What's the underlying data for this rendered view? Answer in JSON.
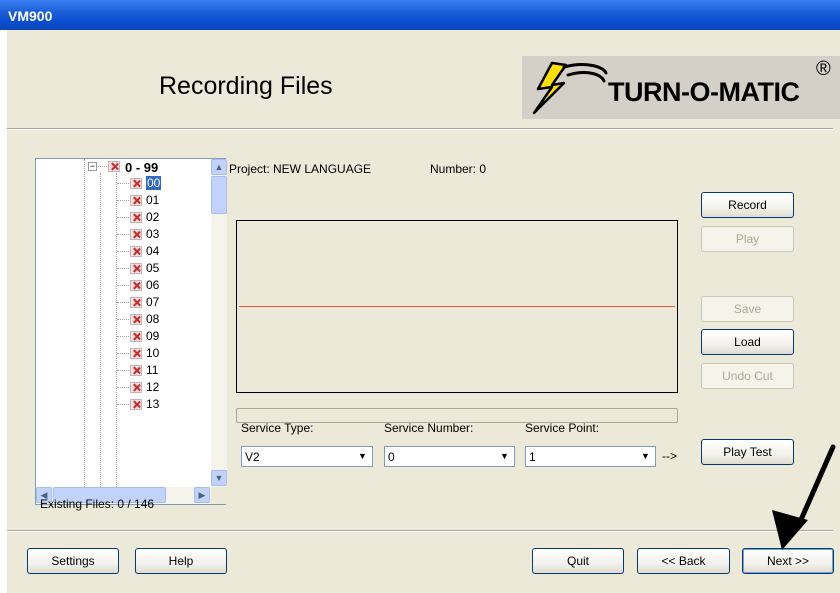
{
  "window": {
    "title": "VM900"
  },
  "header": {
    "title": "Recording Files",
    "logo_text": "TURN-O-MATIC",
    "logo_mark": "®"
  },
  "tree": {
    "root_expander": "−",
    "root_label": "0 - 99",
    "items": [
      "00",
      "01",
      "02",
      "03",
      "04",
      "05",
      "06",
      "07",
      "08",
      "09",
      "10",
      "11",
      "12",
      "13"
    ],
    "selected": "00"
  },
  "info": {
    "project": "Project: NEW LANGUAGE",
    "number": "Number: 0",
    "existing_files": "Existing Files: 0 / 146"
  },
  "buttons": {
    "record": "Record",
    "play": "Play",
    "save": "Save",
    "load": "Load",
    "undo_cut": "Undo Cut",
    "play_test": "Play Test",
    "settings": "Settings",
    "help": "Help",
    "quit": "Quit",
    "back": "<< Back",
    "next": "Next >>"
  },
  "fields": {
    "service_type": {
      "label": "Service Type:",
      "value": "V2"
    },
    "service_number": {
      "label": "Service Number:",
      "value": "0"
    },
    "service_point": {
      "label": "Service Point:",
      "value": "1"
    },
    "arrow_text": "-->"
  },
  "colors": {
    "waveform_line": "#e8572f",
    "title_bar": "#0a4fd0",
    "selection": "#316ac5"
  }
}
